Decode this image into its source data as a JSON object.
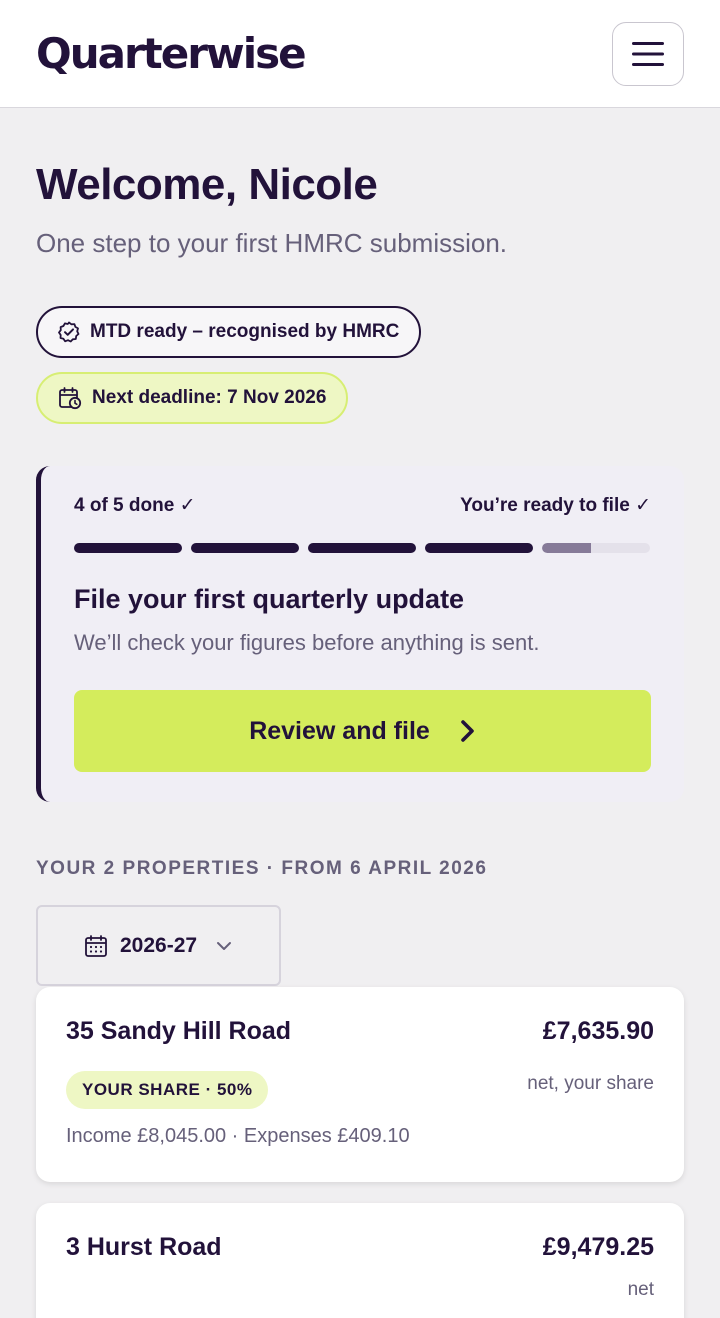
{
  "header": {
    "logo": "Quarterwise",
    "menu_icon": "hamburger-menu-icon"
  },
  "welcome": {
    "title": "Welcome, Nicole",
    "subtitle": "One step to your first HMRC submission."
  },
  "badges": {
    "mtd": {
      "label": "MTD ready – recognised by HMRC",
      "icon": "check-badge-icon"
    },
    "deadline": {
      "label": "Next deadline: 7 Nov 2026",
      "icon": "calendar-clock-icon",
      "color": "#d4ec5c"
    }
  },
  "progress_card": {
    "steps_done_label": "4 of 5 done ✓",
    "ready_label": "You’re ready to file ✓",
    "steps_total": 5,
    "steps_completed": 4,
    "current_step_fraction": 0.45,
    "title": "File your first quarterly update",
    "subtitle": "We’ll check your figures before anything is sent.",
    "cta_label": "Review and file",
    "cta_icon": "chevron-right-icon"
  },
  "properties": {
    "section_label": "YOUR 2 PROPERTIES · FROM 6 APRIL 2026",
    "year_select": {
      "value": "2026-27",
      "icon": "calendar-icon",
      "chevron": "chevron-down-icon"
    },
    "items": [
      {
        "name": "35 Sandy Hill Road",
        "amount": "£7,635.90",
        "caption": "net, your share",
        "share_badge": "YOUR SHARE · 50%",
        "meta": "Income £8,045.00 · Expenses £409.10"
      },
      {
        "name": "3 Hurst Road",
        "amount": "£9,479.25",
        "caption": "net"
      }
    ]
  },
  "colors": {
    "brand_dark": "#22123a",
    "accent_lime": "#d4ec5c",
    "background": "#f0eff1",
    "muted_text": "#66607a"
  }
}
